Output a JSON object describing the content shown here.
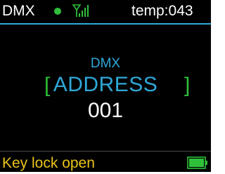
{
  "header": {
    "mode": "DMX",
    "temperature": "temp:043",
    "status_dot_icon": "status-dot-icon",
    "signal_icon": "signal-strength-icon"
  },
  "main": {
    "sub_label": "DMX",
    "bracket_left": "[",
    "title": "ADDRESS",
    "bracket_right": "]",
    "value": "001"
  },
  "footer": {
    "status": "Key lock open",
    "battery_icon": "battery-icon",
    "battery_level": 1.0
  },
  "colors": {
    "background": "#000000",
    "accent_blue": "#2fa8d8",
    "accent_green": "#2fc03a",
    "status_yellow": "#e8c21a",
    "text_white": "#ffffff"
  }
}
